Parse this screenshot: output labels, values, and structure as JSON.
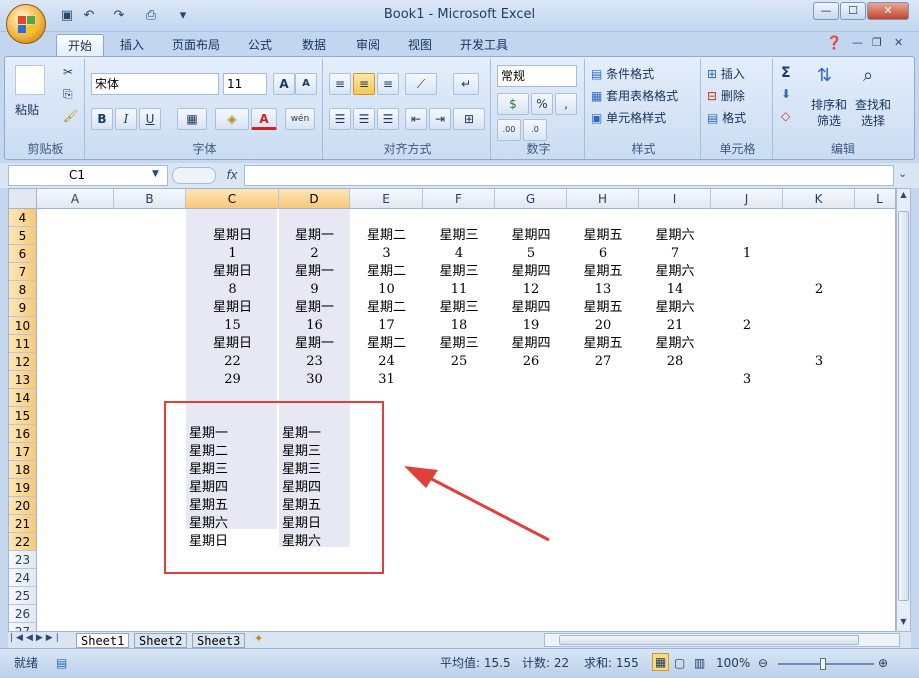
{
  "window": {
    "title": "Book1 - Microsoft Excel",
    "controls": {
      "minimize": "—",
      "maximize": "☐",
      "close": "✕"
    },
    "quick_access": {
      "save": "💾",
      "undo": "↶",
      "redo": "↷",
      "print_preview": "🔍",
      "more": "▾"
    }
  },
  "tabs": [
    "开始",
    "插入",
    "页面布局",
    "公式",
    "数据",
    "审阅",
    "视图",
    "开发工具"
  ],
  "ribbon": {
    "clipboard": {
      "label": "剪贴板",
      "paste": "粘贴"
    },
    "font": {
      "label": "字体",
      "font_name": "宋体",
      "font_size": "11",
      "bold": "B",
      "italic": "I",
      "underline": "U",
      "grow": "A▲",
      "shrink": "A▼",
      "phonetic": "wén"
    },
    "alignment": {
      "label": "对齐方式"
    },
    "number": {
      "label": "数字",
      "format": "常规",
      "percent": "%",
      "comma": ","
    },
    "styles": {
      "label": "样式",
      "conditional": "条件格式",
      "table": "套用表格格式",
      "cell_styles": "单元格样式"
    },
    "cells": {
      "label": "单元格",
      "insert": "插入",
      "delete": "删除",
      "format": "格式"
    },
    "editing": {
      "label": "编辑",
      "sort_filter_1": "排序和",
      "sort_filter_2": "筛选",
      "find_1": "查找和",
      "find_2": "选择"
    }
  },
  "formula_bar": {
    "name_box": "C1",
    "fx": "fx",
    "value": ""
  },
  "columns": [
    "A",
    "B",
    "C",
    "D",
    "E",
    "F",
    "G",
    "H",
    "I",
    "J",
    "K",
    "L"
  ],
  "selected_columns": [
    "C",
    "D"
  ],
  "rows": [
    "4",
    "5",
    "6",
    "7",
    "8",
    "9",
    "10",
    "11",
    "12",
    "13",
    "14",
    "15",
    "16",
    "17",
    "18",
    "19",
    "20",
    "21",
    "22",
    "23",
    "24",
    "25",
    "26",
    "27"
  ],
  "selected_rows": [
    "4",
    "5",
    "6",
    "7",
    "8",
    "9",
    "10",
    "11",
    "12",
    "13",
    "14",
    "15",
    "16",
    "17",
    "18",
    "19",
    "20",
    "21",
    "22"
  ],
  "cells": {
    "r5": [
      "星期日",
      "星期一",
      "星期二",
      "星期三",
      "星期四",
      "星期五",
      "星期六"
    ],
    "r6": [
      "1",
      "2",
      "3",
      "4",
      "5",
      "6",
      "7"
    ],
    "r7": [
      "星期日",
      "星期一",
      "星期二",
      "星期三",
      "星期四",
      "星期五",
      "星期六"
    ],
    "r8": [
      "8",
      "9",
      "10",
      "11",
      "12",
      "13",
      "14"
    ],
    "r9": [
      "星期日",
      "星期一",
      "星期二",
      "星期三",
      "星期四",
      "星期五",
      "星期六"
    ],
    "r10": [
      "15",
      "16",
      "17",
      "18",
      "19",
      "20",
      "21"
    ],
    "r11": [
      "星期日",
      "星期一",
      "星期二",
      "星期三",
      "星期四",
      "星期五",
      "星期六"
    ],
    "r12": [
      "22",
      "23",
      "24",
      "25",
      "26",
      "27",
      "28"
    ],
    "r13": [
      "29",
      "30",
      "31"
    ],
    "J6": "1",
    "J10": "2",
    "J13": "3",
    "K8": "2",
    "K12": "3",
    "C_list": [
      "星期一",
      "星期二",
      "星期三",
      "星期四",
      "星期五",
      "星期六",
      "星期日"
    ],
    "D_list": [
      "星期一",
      "星期三",
      "星期三",
      "星期四",
      "星期五",
      "星期日",
      "星期六"
    ]
  },
  "sheets": [
    "Sheet1",
    "Sheet2",
    "Sheet3"
  ],
  "status": {
    "ready": "就绪",
    "average": "平均值: 15.5",
    "count": "计数: 22",
    "sum": "求和: 155",
    "zoom": "100%"
  },
  "colors": {
    "annotation": "#e0403a",
    "selection": "#e8e8f4",
    "selected_header": "#f7c97a"
  }
}
